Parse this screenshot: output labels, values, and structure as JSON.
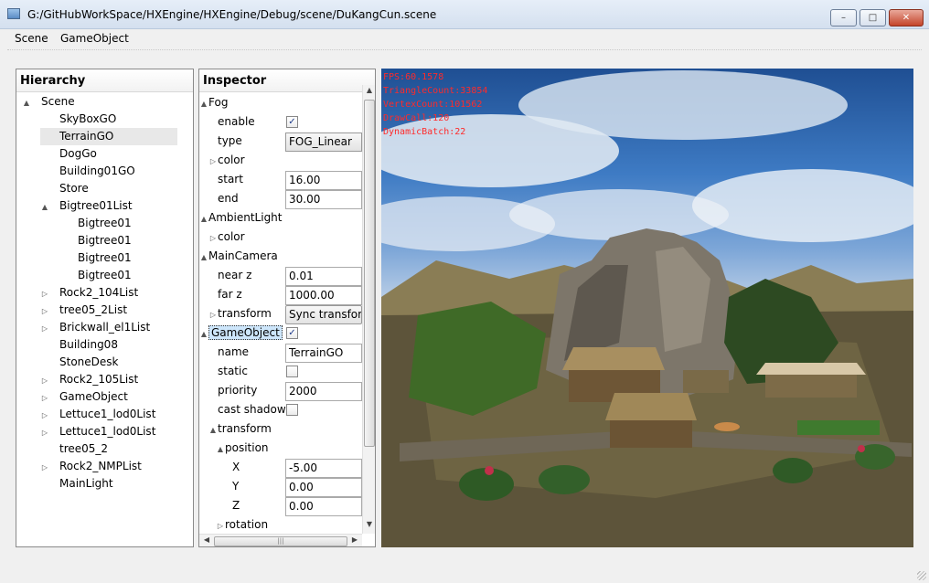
{
  "window": {
    "title": "G:/GitHubWorkSpace/HXEngine/HXEngine/Debug/scene/DuKangCun.scene",
    "buttons": {
      "min": "–",
      "max": "□",
      "close": "✕"
    }
  },
  "menu": [
    "Scene",
    "GameObject"
  ],
  "hierarchy": {
    "title": "Hierarchy",
    "items": [
      {
        "label": "Scene",
        "level": 0,
        "arrow": "▲"
      },
      {
        "label": "SkyBoxGO",
        "level": 1,
        "arrow": ""
      },
      {
        "label": "TerrainGO",
        "level": 1,
        "arrow": "",
        "selected": true
      },
      {
        "label": "DogGo",
        "level": 1,
        "arrow": ""
      },
      {
        "label": "Building01GO",
        "level": 1,
        "arrow": ""
      },
      {
        "label": "Store",
        "level": 1,
        "arrow": ""
      },
      {
        "label": "Bigtree01List",
        "level": 1,
        "arrow": "▲"
      },
      {
        "label": "Bigtree01",
        "level": 2,
        "arrow": ""
      },
      {
        "label": "Bigtree01",
        "level": 2,
        "arrow": ""
      },
      {
        "label": "Bigtree01",
        "level": 2,
        "arrow": ""
      },
      {
        "label": "Bigtree01",
        "level": 2,
        "arrow": ""
      },
      {
        "label": "Rock2_104List",
        "level": 1,
        "arrow": "▷"
      },
      {
        "label": "tree05_2List",
        "level": 1,
        "arrow": "▷"
      },
      {
        "label": "Brickwall_el1List",
        "level": 1,
        "arrow": "▷"
      },
      {
        "label": "Building08",
        "level": 1,
        "arrow": ""
      },
      {
        "label": "StoneDesk",
        "level": 1,
        "arrow": ""
      },
      {
        "label": "Rock2_105List",
        "level": 1,
        "arrow": "▷"
      },
      {
        "label": "GameObject",
        "level": 1,
        "arrow": "▷"
      },
      {
        "label": "Lettuce1_lod0List",
        "level": 1,
        "arrow": "▷"
      },
      {
        "label": "Lettuce1_lod0List",
        "level": 1,
        "arrow": "▷"
      },
      {
        "label": "tree05_2",
        "level": 1,
        "arrow": ""
      },
      {
        "label": "Rock2_NMPList",
        "level": 1,
        "arrow": "▷"
      },
      {
        "label": "MainLight",
        "level": 1,
        "arrow": ""
      }
    ]
  },
  "inspector": {
    "title": "Inspector",
    "rows": [
      {
        "label": "Fog",
        "indent": 0,
        "arrow": "▲"
      },
      {
        "label": "enable",
        "indent": 1,
        "arrow": "",
        "check": true
      },
      {
        "label": "type",
        "indent": 1,
        "arrow": "",
        "combo": "FOG_Linear"
      },
      {
        "label": "color",
        "indent": 1,
        "arrow": "▷"
      },
      {
        "label": "start",
        "indent": 1,
        "arrow": "",
        "value": "16.00"
      },
      {
        "label": "end",
        "indent": 1,
        "arrow": "",
        "value": "30.00"
      },
      {
        "label": "AmbientLight",
        "indent": 0,
        "arrow": "▲"
      },
      {
        "label": "color",
        "indent": 1,
        "arrow": "▷"
      },
      {
        "label": "MainCamera",
        "indent": 0,
        "arrow": "▲"
      },
      {
        "label": "near z",
        "indent": 1,
        "arrow": "",
        "value": "0.01"
      },
      {
        "label": "far z",
        "indent": 1,
        "arrow": "",
        "value": "1000.00"
      },
      {
        "label": "transform",
        "indent": 1,
        "arrow": "▷",
        "button": "Sync transform"
      },
      {
        "label": "GameObject",
        "indent": 0,
        "arrow": "▲",
        "check": true,
        "selected": true
      },
      {
        "label": "name",
        "indent": 1,
        "arrow": "",
        "value": "TerrainGO"
      },
      {
        "label": "static",
        "indent": 1,
        "arrow": "",
        "check": false
      },
      {
        "label": "priority",
        "indent": 1,
        "arrow": "",
        "value": "2000"
      },
      {
        "label": "cast shadow",
        "indent": 1,
        "arrow": "",
        "check": false
      },
      {
        "label": "transform",
        "indent": 1,
        "arrow": "▲"
      },
      {
        "label": "position",
        "indent": 2,
        "arrow": "▲"
      },
      {
        "label": "X",
        "indent": 3,
        "arrow": "",
        "value": "-5.00"
      },
      {
        "label": "Y",
        "indent": 3,
        "arrow": "",
        "value": "0.00"
      },
      {
        "label": "Z",
        "indent": 3,
        "arrow": "",
        "value": "0.00"
      },
      {
        "label": "rotation",
        "indent": 2,
        "arrow": "▷"
      }
    ]
  },
  "viewport": {
    "stats": [
      "FPS:60.1578",
      "TriangleCount:33854",
      "VertexCount:101562",
      "DrawCall:120",
      "DynamicBatch:22"
    ],
    "stats_color": "#ff2a2a"
  }
}
